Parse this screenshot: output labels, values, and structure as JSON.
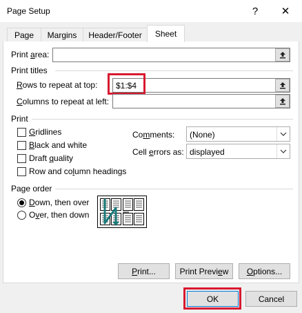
{
  "dialog": {
    "title": "Page Setup",
    "help_glyph": "?",
    "close_glyph": "✕"
  },
  "tabs": [
    {
      "label": "Page",
      "active": false
    },
    {
      "label": "Margins",
      "active": false
    },
    {
      "label": "Header/Footer",
      "active": false
    },
    {
      "label": "Sheet",
      "active": true
    }
  ],
  "print_area": {
    "label_pre": "Print ",
    "label_u": "a",
    "label_post": "rea:",
    "value": ""
  },
  "print_titles": {
    "section_label": "Print titles",
    "rows": {
      "label_pre": "",
      "label_u": "R",
      "label_post": "ows to repeat at top:",
      "value": "$1:$4"
    },
    "columns": {
      "label_pre": "",
      "label_u": "C",
      "label_post": "olumns to repeat at left:",
      "value": ""
    }
  },
  "print": {
    "section_label": "Print",
    "checkboxes": [
      {
        "label_pre": "",
        "label_u": "G",
        "label_post": "ridlines",
        "checked": false
      },
      {
        "label_pre": "",
        "label_u": "B",
        "label_post": "lack and white",
        "checked": false
      },
      {
        "label_pre": "Draft ",
        "label_u": "q",
        "label_post": "uality",
        "checked": false
      },
      {
        "label_pre": "Row and co",
        "label_u": "l",
        "label_post": "umn headings",
        "checked": false
      }
    ],
    "comments": {
      "label_pre": "Co",
      "label_u": "m",
      "label_post": "ments:",
      "value": "(None)"
    },
    "cell_errors": {
      "label_pre": "Cell ",
      "label_u": "e",
      "label_post": "rrors as:",
      "value": "displayed"
    }
  },
  "page_order": {
    "section_label": "Page order",
    "options": [
      {
        "label_pre": "",
        "label_u": "D",
        "label_post": "own, then over",
        "selected": true
      },
      {
        "label_pre": "O",
        "label_u": "v",
        "label_post": "er, then down",
        "selected": false
      }
    ]
  },
  "buttons": {
    "print": {
      "label_pre": "",
      "label_u": "P",
      "label_post": "rint..."
    },
    "preview": {
      "label_pre": "Print Previ",
      "label_u": "e",
      "label_post": "w"
    },
    "options": {
      "label_pre": "",
      "label_u": "O",
      "label_post": "ptions..."
    },
    "ok": "OK",
    "cancel": "Cancel"
  },
  "colors": {
    "highlight": "#d7192f",
    "accent": "#0078d7",
    "diagram_arrow": "#1a7a7a"
  }
}
